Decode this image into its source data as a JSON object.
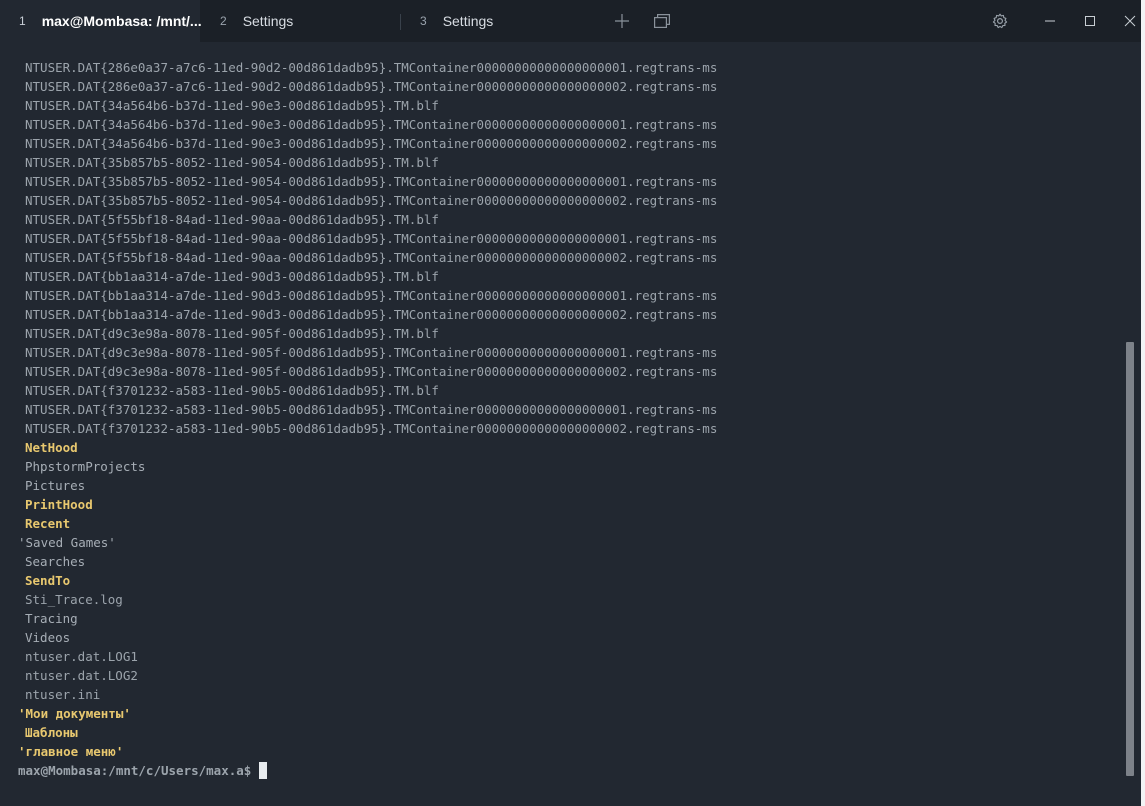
{
  "tabs": [
    {
      "number": "1",
      "title": "max@Mombasa: /mnt/...",
      "active": true
    },
    {
      "number": "2",
      "title": "Settings",
      "active": false
    },
    {
      "number": "3",
      "title": "Settings",
      "active": false
    }
  ],
  "colors": {
    "background": "#222831",
    "tabbar": "#1b2027",
    "text": "#9ca4ac",
    "directory": "#e8c86f",
    "cursor": "#e8ecef"
  },
  "icons": {
    "new_tab": "plus-icon",
    "tab_overview": "overlapping-windows-icon",
    "settings": "gear-icon",
    "minimize": "minimize-icon",
    "maximize": "maximize-icon",
    "close": "close-icon"
  },
  "output": [
    {
      "text": "NTUSER.DAT{286e0a37-a7c6-11ed-90d2-00d861dadb95}.TMContainer00000000000000000001.regtrans-ms",
      "kind": "file"
    },
    {
      "text": "NTUSER.DAT{286e0a37-a7c6-11ed-90d2-00d861dadb95}.TMContainer00000000000000000002.regtrans-ms",
      "kind": "file"
    },
    {
      "text": "NTUSER.DAT{34a564b6-b37d-11ed-90e3-00d861dadb95}.TM.blf",
      "kind": "file"
    },
    {
      "text": "NTUSER.DAT{34a564b6-b37d-11ed-90e3-00d861dadb95}.TMContainer00000000000000000001.regtrans-ms",
      "kind": "file"
    },
    {
      "text": "NTUSER.DAT{34a564b6-b37d-11ed-90e3-00d861dadb95}.TMContainer00000000000000000002.regtrans-ms",
      "kind": "file"
    },
    {
      "text": "NTUSER.DAT{35b857b5-8052-11ed-9054-00d861dadb95}.TM.blf",
      "kind": "file"
    },
    {
      "text": "NTUSER.DAT{35b857b5-8052-11ed-9054-00d861dadb95}.TMContainer00000000000000000001.regtrans-ms",
      "kind": "file"
    },
    {
      "text": "NTUSER.DAT{35b857b5-8052-11ed-9054-00d861dadb95}.TMContainer00000000000000000002.regtrans-ms",
      "kind": "file"
    },
    {
      "text": "NTUSER.DAT{5f55bf18-84ad-11ed-90aa-00d861dadb95}.TM.blf",
      "kind": "file"
    },
    {
      "text": "NTUSER.DAT{5f55bf18-84ad-11ed-90aa-00d861dadb95}.TMContainer00000000000000000001.regtrans-ms",
      "kind": "file"
    },
    {
      "text": "NTUSER.DAT{5f55bf18-84ad-11ed-90aa-00d861dadb95}.TMContainer00000000000000000002.regtrans-ms",
      "kind": "file"
    },
    {
      "text": "NTUSER.DAT{bb1aa314-a7de-11ed-90d3-00d861dadb95}.TM.blf",
      "kind": "file"
    },
    {
      "text": "NTUSER.DAT{bb1aa314-a7de-11ed-90d3-00d861dadb95}.TMContainer00000000000000000001.regtrans-ms",
      "kind": "file"
    },
    {
      "text": "NTUSER.DAT{bb1aa314-a7de-11ed-90d3-00d861dadb95}.TMContainer00000000000000000002.regtrans-ms",
      "kind": "file"
    },
    {
      "text": "NTUSER.DAT{d9c3e98a-8078-11ed-905f-00d861dadb95}.TM.blf",
      "kind": "file"
    },
    {
      "text": "NTUSER.DAT{d9c3e98a-8078-11ed-905f-00d861dadb95}.TMContainer00000000000000000001.regtrans-ms",
      "kind": "file"
    },
    {
      "text": "NTUSER.DAT{d9c3e98a-8078-11ed-905f-00d861dadb95}.TMContainer00000000000000000002.regtrans-ms",
      "kind": "file"
    },
    {
      "text": "NTUSER.DAT{f3701232-a583-11ed-90b5-00d861dadb95}.TM.blf",
      "kind": "file"
    },
    {
      "text": "NTUSER.DAT{f3701232-a583-11ed-90b5-00d861dadb95}.TMContainer00000000000000000001.regtrans-ms",
      "kind": "file"
    },
    {
      "text": "NTUSER.DAT{f3701232-a583-11ed-90b5-00d861dadb95}.TMContainer00000000000000000002.regtrans-ms",
      "kind": "file"
    },
    {
      "text": "NetHood",
      "kind": "dir"
    },
    {
      "text": "PhpstormProjects",
      "kind": "plain"
    },
    {
      "text": "Pictures",
      "kind": "plain"
    },
    {
      "text": "PrintHood",
      "kind": "dir"
    },
    {
      "text": "Recent",
      "kind": "dir"
    },
    {
      "text": "'Saved Games'",
      "kind": "plain-quoted"
    },
    {
      "text": "Searches",
      "kind": "plain"
    },
    {
      "text": "SendTo",
      "kind": "dir"
    },
    {
      "text": "Sti_Trace.log",
      "kind": "file"
    },
    {
      "text": "Tracing",
      "kind": "plain"
    },
    {
      "text": "Videos",
      "kind": "plain"
    },
    {
      "text": "ntuser.dat.LOG1",
      "kind": "file"
    },
    {
      "text": "ntuser.dat.LOG2",
      "kind": "file"
    },
    {
      "text": "ntuser.ini",
      "kind": "file"
    },
    {
      "text": "'Мои документы'",
      "kind": "dir-quoted"
    },
    {
      "text": "Шаблоны",
      "kind": "dir"
    },
    {
      "text": "'главное меню'",
      "kind": "dir-quoted"
    }
  ],
  "prompt": "max@Mombasa:/mnt/c/Users/max.a$"
}
